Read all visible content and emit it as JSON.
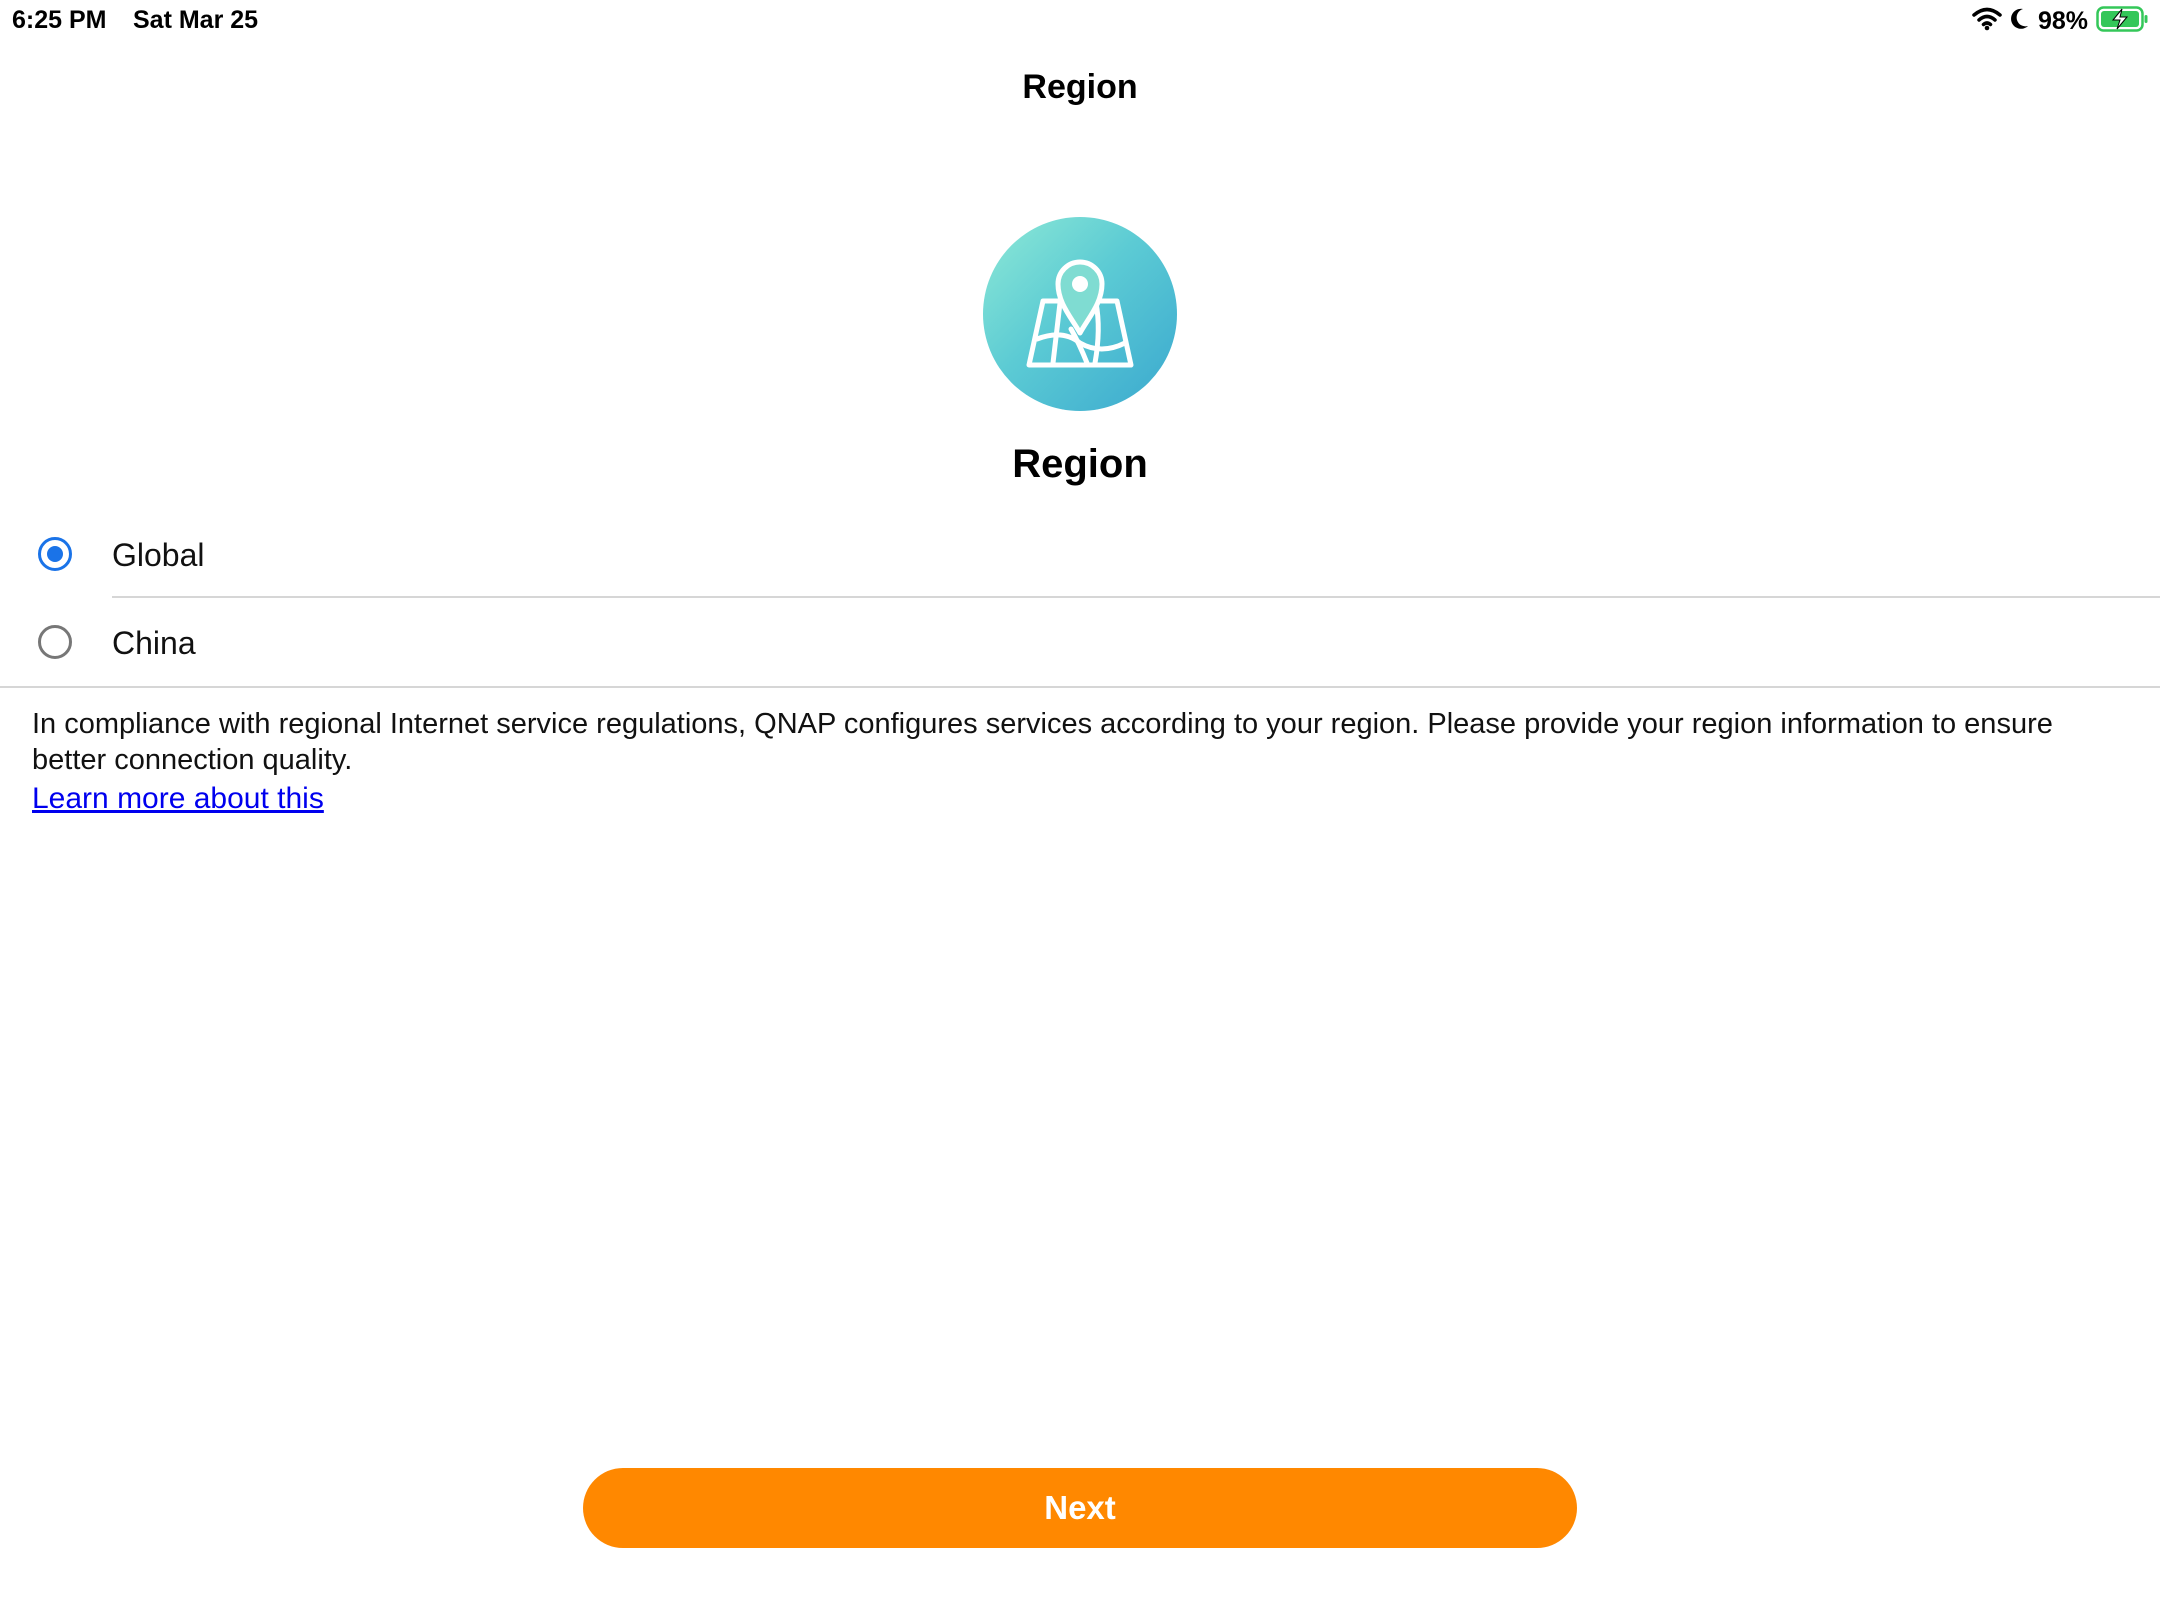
{
  "status_bar": {
    "time": "6:25 PM",
    "date": "Sat Mar 25",
    "battery_percent": "98%",
    "icons": [
      "wifi-icon",
      "moon-icon",
      "battery-charging-icon"
    ]
  },
  "nav": {
    "title": "Region"
  },
  "hero": {
    "icon": "map-pin-icon",
    "title": "Region"
  },
  "options": [
    {
      "label": "Global",
      "selected": true
    },
    {
      "label": "China",
      "selected": false
    }
  ],
  "description": {
    "text": "In compliance with regional Internet service regulations, QNAP configures services according to your region. Please provide your region information to ensure better connection quality.",
    "link": "Learn more about this"
  },
  "actions": {
    "next_label": "Next"
  },
  "colors": {
    "accent_blue": "#1a73e8",
    "button_orange": "#ff8800",
    "link_blue": "#0000ee",
    "battery_green": "#34c759"
  }
}
